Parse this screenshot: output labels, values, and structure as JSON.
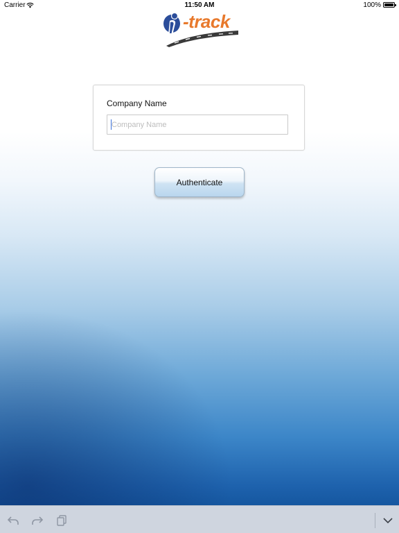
{
  "status_bar": {
    "carrier": "Carrier",
    "wifi_icon": "wifi-icon",
    "time": "11:50 AM",
    "battery_percent": "100%",
    "battery_icon": "battery-icon"
  },
  "logo": {
    "text": "-track",
    "icon": "i-track-logo",
    "colors": {
      "text": "#e8792c",
      "mark": "#2b4d9a"
    }
  },
  "form": {
    "company_label": "Company Name",
    "company_value": "",
    "company_placeholder": "Company Name"
  },
  "auth_button": {
    "label": "Authenticate"
  },
  "shortcut_bar": {
    "icons": [
      "undo-icon",
      "redo-icon",
      "paste-icon",
      "keyboard-dismiss-icon"
    ]
  },
  "colors": {
    "background_top": "#ffffff",
    "background_bottom": "#1557a0",
    "accent_orange": "#e8792c"
  }
}
